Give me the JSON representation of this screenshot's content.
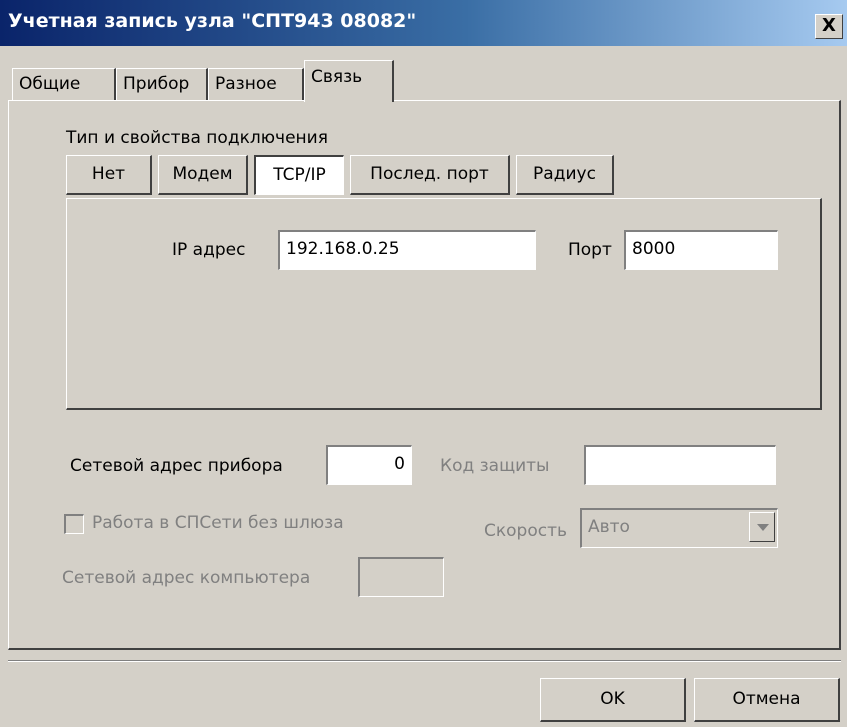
{
  "window": {
    "title": "Учетная запись узла \"СПТ943 08082\"",
    "close": "X"
  },
  "tabs": [
    {
      "label": "Общие"
    },
    {
      "label": "Прибор"
    },
    {
      "label": "Разное"
    },
    {
      "label": "Связь"
    }
  ],
  "connection": {
    "group_label": "Тип и свойства подключения",
    "buttons": [
      {
        "label": "Нет"
      },
      {
        "label": "Модем"
      },
      {
        "label": "TCP/IP"
      },
      {
        "label": "Послед. порт"
      },
      {
        "label": "Радиус"
      }
    ],
    "selected": "TCP/IP",
    "ip_label": "IP адрес",
    "ip_value": "192.168.0.25",
    "port_label": "Порт",
    "port_value": "8000"
  },
  "device": {
    "net_address_label": "Сетевой адрес прибора",
    "net_address_value": "0",
    "protection_code_label": "Код защиты",
    "protection_code_value": "",
    "no_gateway_label": "Работа в СПСети без шлюза",
    "speed_label": "Скорость",
    "speed_value": "Авто",
    "computer_address_label": "Сетевой адрес компьютера",
    "computer_address_value": ""
  },
  "footer": {
    "ok": "OK",
    "cancel": "Отмена"
  }
}
